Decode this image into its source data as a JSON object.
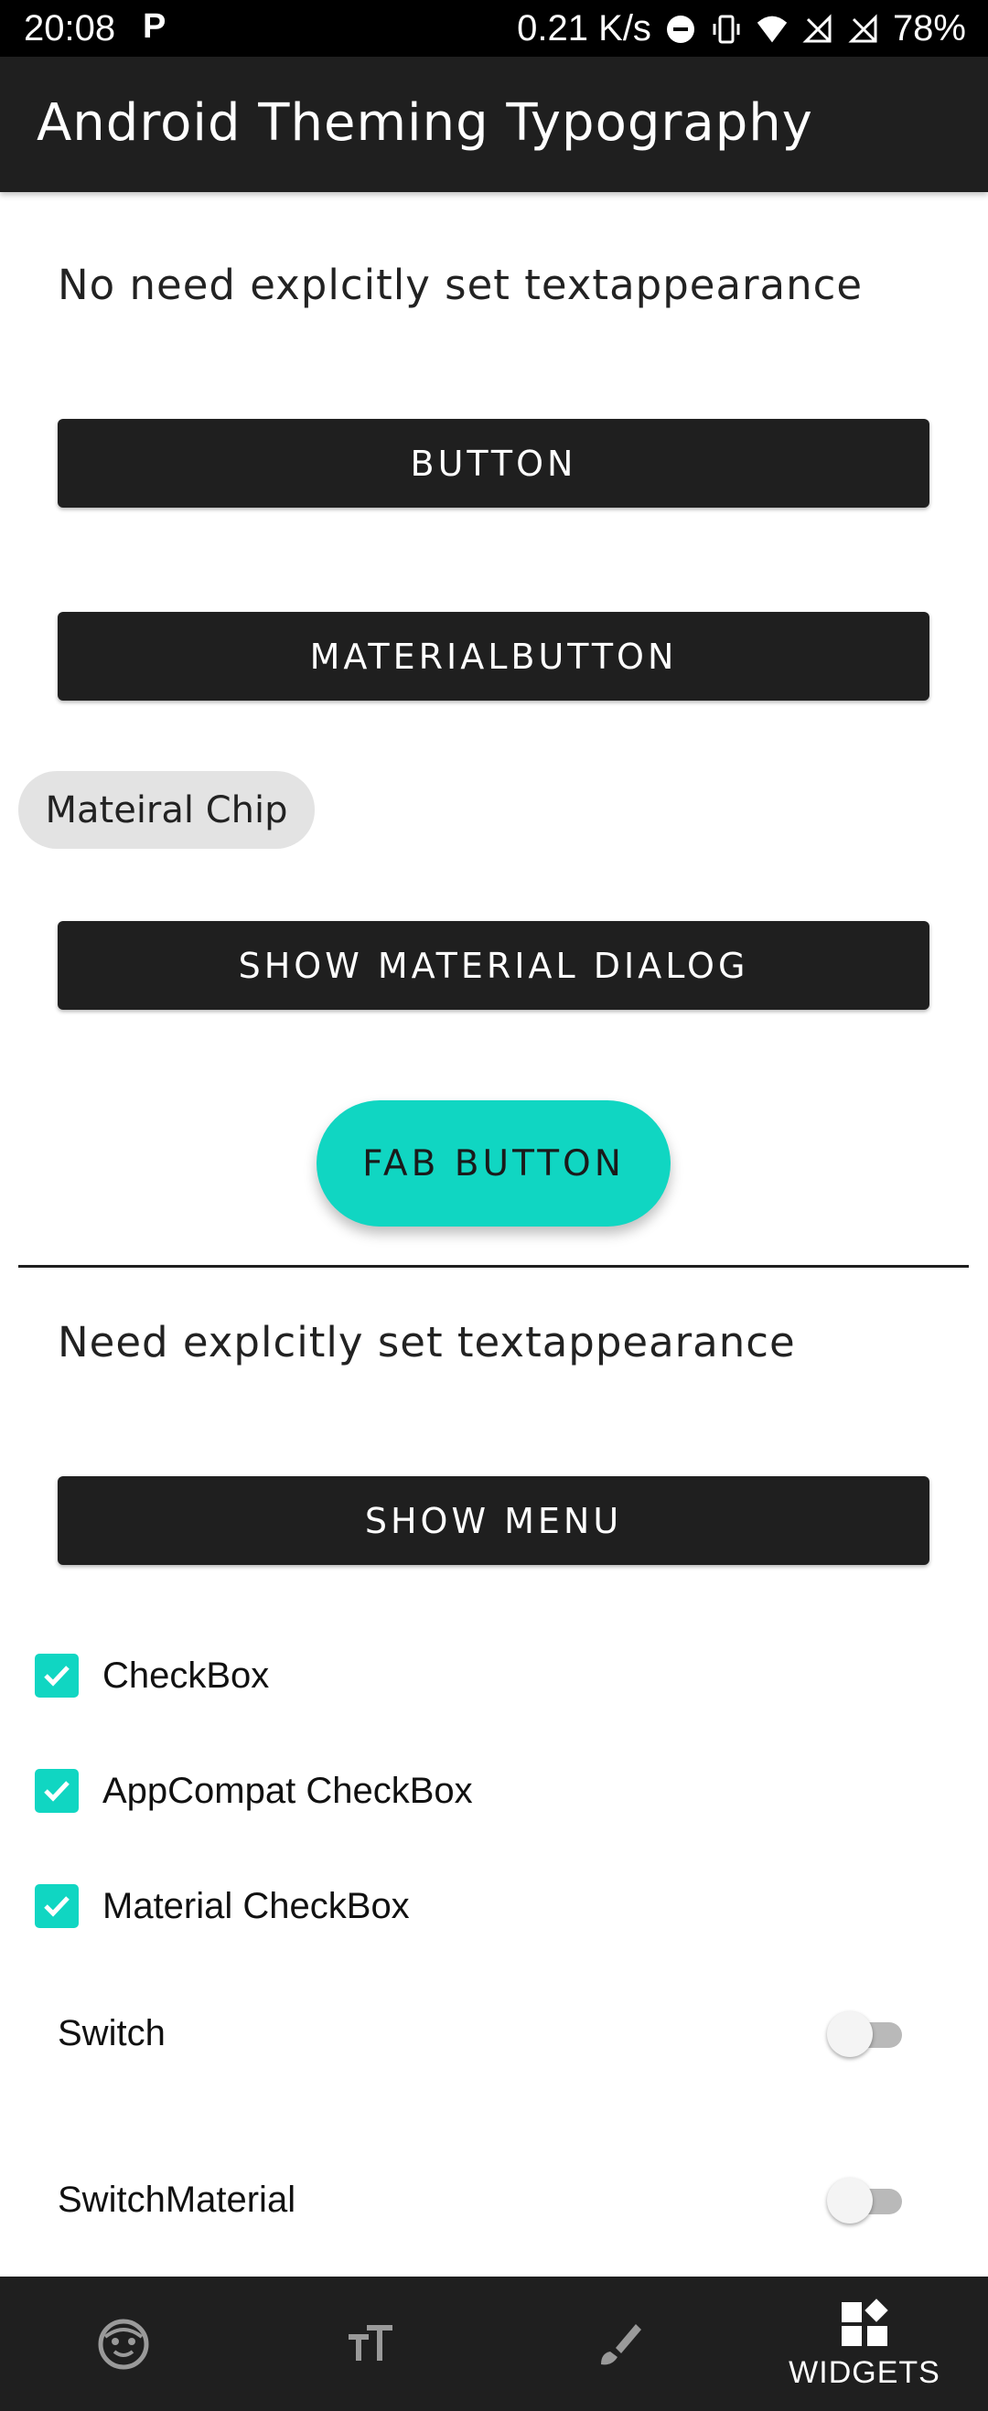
{
  "status_bar": {
    "time": "20:08",
    "notification_glyph": "P",
    "network_speed": "0.21 K/s",
    "battery": "78%",
    "icons": [
      "dnd-icon",
      "vibrate-icon",
      "wifi-icon",
      "no-sim-icon",
      "no-signal-icon",
      "battery-icon"
    ]
  },
  "app_bar": {
    "title": "Android Theming Typography"
  },
  "section1": {
    "heading": "No need explcitly set textappearance",
    "button_label": "BUTTON",
    "material_button_label": "MATERIALBUTTON",
    "chip_label": "Mateiral Chip",
    "dialog_button_label": "SHOW MATERIAL DIALOG",
    "fab_label": "FAB BUTTON"
  },
  "section2": {
    "heading": "Need explcitly set textappearance",
    "menu_button_label": "SHOW MENU",
    "checkboxes": [
      {
        "label": "CheckBox",
        "checked": true
      },
      {
        "label": "AppCompat CheckBox",
        "checked": true
      },
      {
        "label": "Material CheckBox",
        "checked": true
      }
    ],
    "switches": [
      {
        "label": "Switch",
        "on": false
      },
      {
        "label": "SwitchMaterial",
        "on": false
      }
    ]
  },
  "bottom_nav": {
    "items": [
      {
        "icon": "face-icon",
        "label": ""
      },
      {
        "icon": "text-size-icon",
        "label": ""
      },
      {
        "icon": "brush-icon",
        "label": ""
      },
      {
        "icon": "widgets-icon",
        "label": "WIDGETS",
        "selected": true
      }
    ]
  },
  "colors": {
    "accent": "#10d6c2",
    "primary_dark": "#1f1f1f",
    "chip_bg": "#e3e3e3"
  }
}
